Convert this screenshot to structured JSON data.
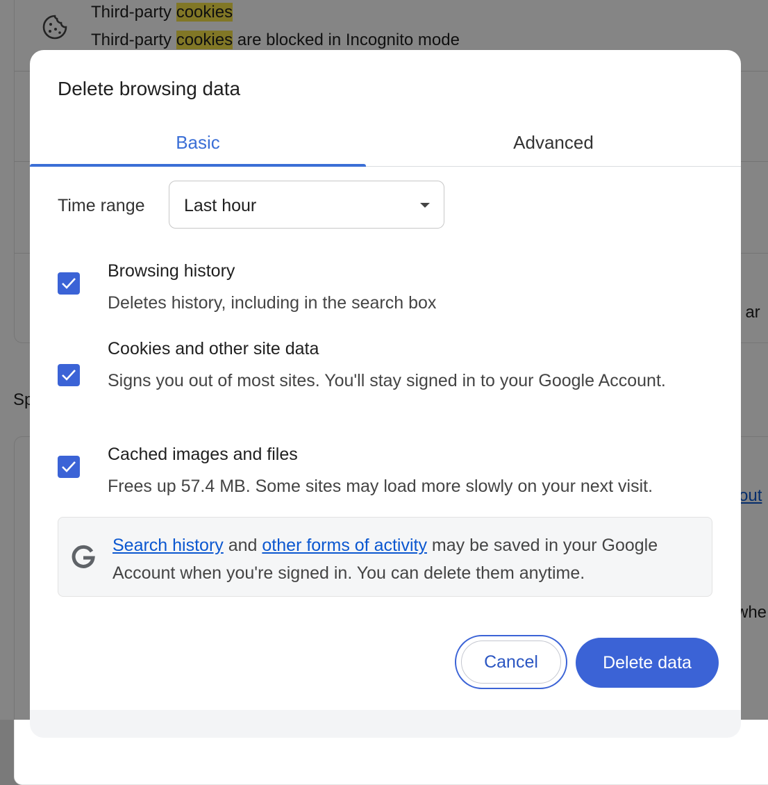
{
  "background": {
    "cookies_row": {
      "icon": "cookie-icon",
      "title_prefix": "Third-party ",
      "title_highlight": "cookies",
      "subtitle_prefix": "Third-party ",
      "subtitle_highlight": "cookies",
      "subtitle_suffix": " are blocked in Incognito mode"
    },
    "section_fragment": "Sp",
    "right_fragment_1": ", ar",
    "right_link_fragment": "out",
    "right_fragment_2": "whe"
  },
  "dialog": {
    "title": "Delete browsing data",
    "tabs": [
      {
        "label": "Basic",
        "active": true
      },
      {
        "label": "Advanced",
        "active": false
      }
    ],
    "time_range": {
      "label": "Time range",
      "value": "Last hour",
      "icon": "dropdown-arrow-icon"
    },
    "options": [
      {
        "title": "Browsing history",
        "description": "Deletes history, including in the search box",
        "checked": true
      },
      {
        "title": "Cookies and other site data",
        "description": "Signs you out of most sites. You'll stay signed in to your Google Account.",
        "checked": true
      },
      {
        "title": "Cached images and files",
        "description": "Frees up 57.4 MB. Some sites may load more slowly on your next visit.",
        "checked": true
      }
    ],
    "info": {
      "icon": "google-g-icon",
      "link1": "Search history",
      "text1": " and ",
      "link2": "other forms of activity",
      "text2": " may be saved in your Google Account when you're signed in. You can delete them anytime."
    },
    "buttons": {
      "cancel": "Cancel",
      "delete": "Delete data"
    },
    "colors": {
      "accent": "#3b63d6",
      "link": "#0b57d0",
      "highlight": "#f7e44a"
    }
  }
}
